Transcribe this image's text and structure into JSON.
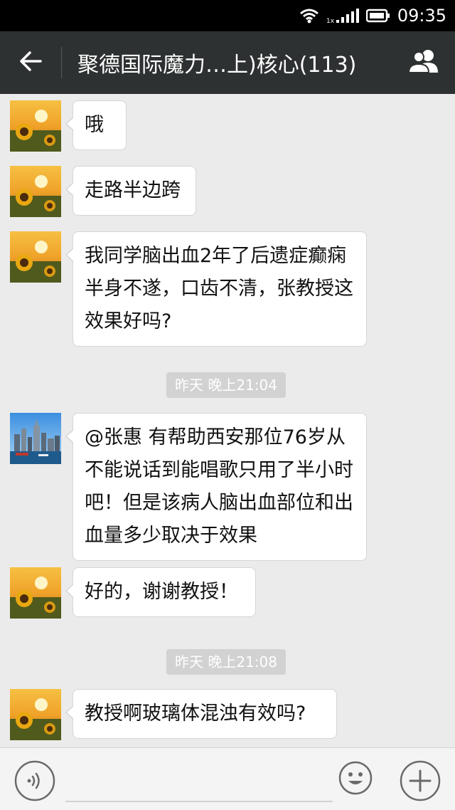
{
  "status_bar": {
    "time": "09:35",
    "wifi_icon": "wifi-icon",
    "signal_icon": "signal-icon",
    "battery_icon": "battery-icon"
  },
  "header": {
    "back_icon": "arrow-left-icon",
    "title": "聚德国际魔力…上)核心(113)",
    "members_icon": "group-members-icon"
  },
  "messages": [
    {
      "type": "msg",
      "avatar": "sunflower",
      "text": "哦"
    },
    {
      "type": "msg",
      "avatar": "sunflower",
      "text": "走路半边跨"
    },
    {
      "type": "msg",
      "avatar": "sunflower",
      "text": "我同学脑出血2年了后遗症癫痫半身不遂，口齿不清，张教授这效果好吗?"
    },
    {
      "type": "timestamp",
      "text": "昨天 晚上21:04"
    },
    {
      "type": "msg",
      "avatar": "city",
      "text": "@张惠 有帮助西安那位76岁从不能说话到能唱歌只用了半小时吧！但是该病人脑出血部位和出血量多少取决于效果"
    },
    {
      "type": "msg",
      "avatar": "sunflower",
      "text": "好的，谢谢教授！"
    },
    {
      "type": "timestamp",
      "text": "昨天 晚上21:08"
    },
    {
      "type": "msg",
      "avatar": "sunflower",
      "text": "教授啊玻璃体混浊有效吗?"
    }
  ],
  "input_bar": {
    "voice_icon": "voice-icon",
    "input_value": "",
    "emoji_icon": "emoji-icon",
    "plus_icon": "plus-icon"
  },
  "colors": {
    "header_bg": "#2e3132",
    "chat_bg": "#ebebeb",
    "bubble_bg": "#ffffff",
    "timestamp_bg": "#d2d2d2"
  }
}
